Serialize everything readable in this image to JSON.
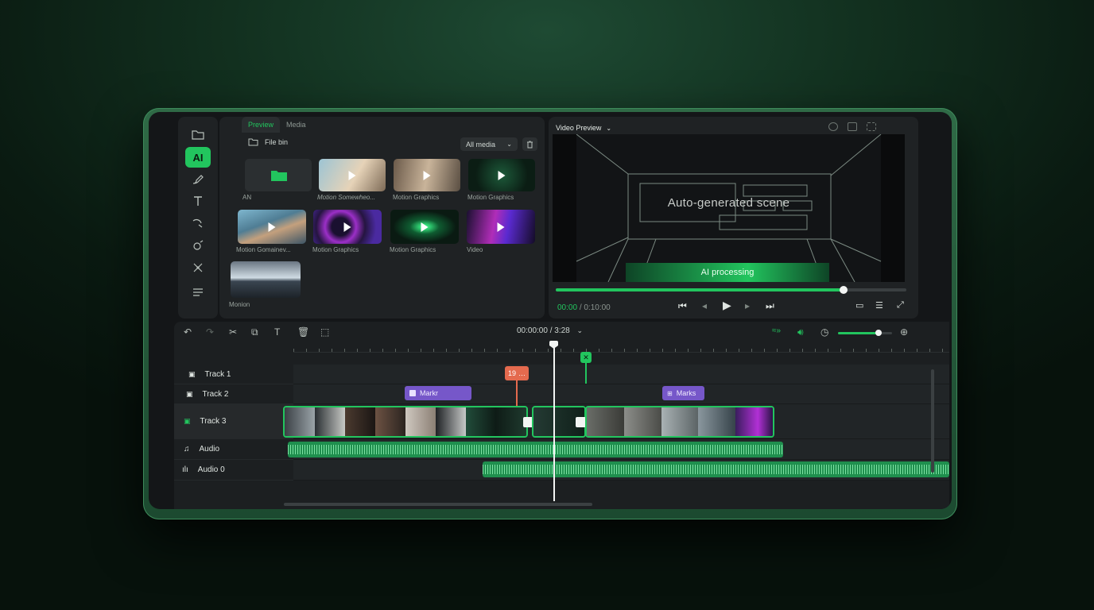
{
  "sidebar": {
    "ai_label": "AI",
    "tools": [
      "folder-icon",
      "ai-button",
      "brush-icon",
      "text-icon",
      "pen-icon",
      "magic-icon",
      "nodes-icon",
      "menu-icon"
    ]
  },
  "media_panel": {
    "tabs": [
      "Preview",
      "Media"
    ],
    "file_bin": "File bin",
    "filter": "All media",
    "items": [
      {
        "caption": "AN"
      },
      {
        "caption": "Motion Somewheo..."
      },
      {
        "caption": "Motion Graphics"
      },
      {
        "caption": "Motion Graphics"
      },
      {
        "caption": "Motion Gomainev..."
      },
      {
        "caption": "Motion Graphics"
      },
      {
        "caption": "Motion Graphics"
      },
      {
        "caption": "Video"
      },
      {
        "caption": "Monion"
      }
    ]
  },
  "preview": {
    "title": "Video Preview",
    "scene_label": "Auto-generated scene",
    "ai_status": "AI processing",
    "current_time": "00:00",
    "total_time": "/ 0:10:00",
    "progress": 0.82
  },
  "timeline": {
    "timecode": "00:00:00 / 3:28",
    "zoom": 0.75,
    "tracks": [
      "Track 1",
      "Track 2",
      "Track 3",
      "Audio",
      "Audio 0"
    ],
    "markers": [
      {
        "label": "Markr"
      },
      {
        "label": "Marks"
      },
      {
        "label": "19"
      }
    ]
  },
  "colors": {
    "accent": "#22c55e",
    "marker": "#7657c9",
    "warning": "#e46a4e"
  }
}
